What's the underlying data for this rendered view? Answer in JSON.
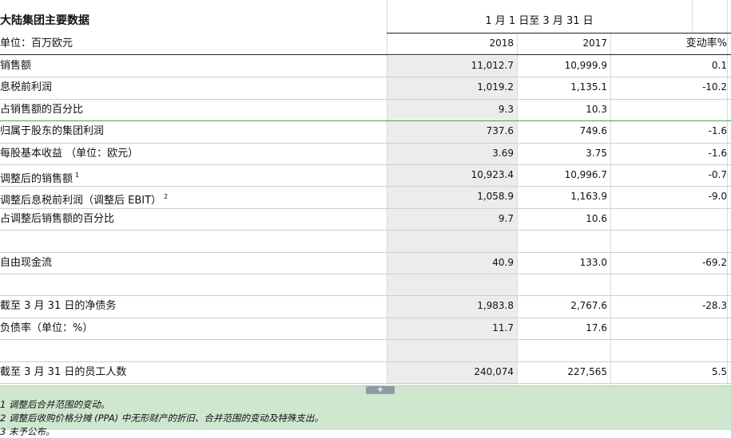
{
  "table": {
    "title": "大陆集团主要数据",
    "period": "1 月 1 日至 3 月 31 日",
    "unit": "单位：百万欧元",
    "col_2018": "2018",
    "col_2017": "2017",
    "col_change": "变动率%",
    "rows": [
      {
        "label": "销售额",
        "sup": "",
        "v2018": "11,012.7",
        "v2017": "10,999.9",
        "change": "0.1"
      },
      {
        "label": "息税前利润",
        "sup": "",
        "v2018": "1,019.2",
        "v2017": "1,135.1",
        "change": "-10.2"
      },
      {
        "label": "占销售额的百分比",
        "sup": "",
        "v2018": "9.3",
        "v2017": "10.3",
        "change": ""
      },
      {
        "label": "归属于股东的集团利润",
        "sup": "",
        "v2018": "737.6",
        "v2017": "749.6",
        "change": "-1.6"
      },
      {
        "label": "每股基本收益 （单位：欧元）",
        "sup": "",
        "v2018": "3.69",
        "v2017": "3.75",
        "change": "-1.6"
      },
      {
        "label": "调整后的销售额",
        "sup": "1",
        "v2018": "10,923.4",
        "v2017": "10,996.7",
        "change": "-0.7"
      },
      {
        "label": "调整后息税前利润（调整后 EBIT）",
        "sup": "2",
        "v2018": "1,058.9",
        "v2017": "1,163.9",
        "change": "-9.0"
      },
      {
        "label": "占调整后销售额的百分比",
        "sup": "",
        "v2018": "9.7",
        "v2017": "10.6",
        "change": ""
      },
      {
        "label": "",
        "sup": "",
        "v2018": "",
        "v2017": "",
        "change": ""
      },
      {
        "label": "自由现金流",
        "sup": "",
        "v2018": "40.9",
        "v2017": "133.0",
        "change": "-69.2"
      },
      {
        "label": "",
        "sup": "",
        "v2018": "",
        "v2017": "",
        "change": ""
      },
      {
        "label": "截至 3 月 31 日的净债务",
        "sup": "",
        "v2018": "1,983.8",
        "v2017": "2,767.6",
        "change": "-28.3"
      },
      {
        "label": "负债率（单位：%）",
        "sup": "",
        "v2018": "11.7",
        "v2017": "17.6",
        "change": ""
      },
      {
        "label": "",
        "sup": "",
        "v2018": "",
        "v2017": "",
        "change": ""
      },
      {
        "label": "截至 3 月 31 日的员工人数",
        "sup": "",
        "v2018": "240,074",
        "v2017": "227,565",
        "change": "5.5"
      }
    ]
  },
  "footnotes": [
    "1 调整后合并范围的变动。",
    "2 调整后收购价格分摊 (PPA) 中无形财产的折旧、合并范围的变动及特殊支出。",
    "3 未予公布。"
  ],
  "expand_button": "+",
  "colors": {
    "shade": "#ececec",
    "footer_bg": "#cfe7cf",
    "grid": "#cfcfcf"
  }
}
